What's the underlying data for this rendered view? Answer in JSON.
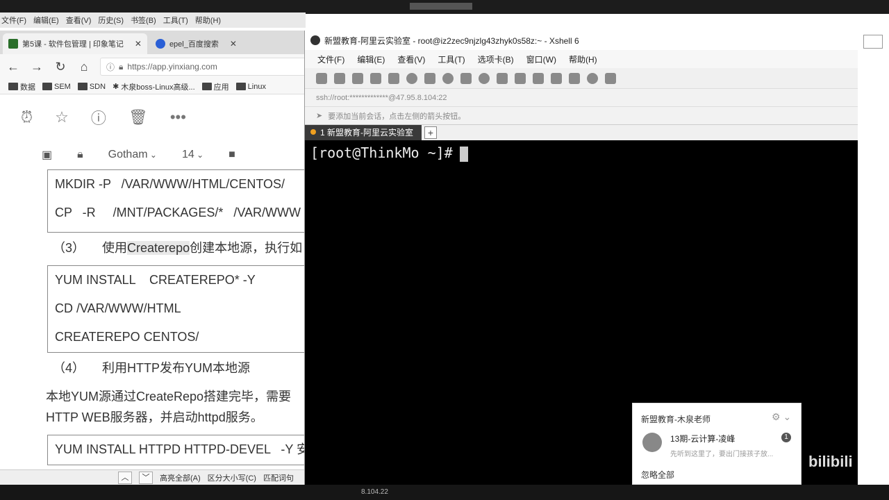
{
  "browser": {
    "menu": [
      "文件(F)",
      "编辑(E)",
      "查看(V)",
      "历史(S)",
      "书签(B)",
      "工具(T)",
      "帮助(H)"
    ],
    "tabs": [
      {
        "title": "第5课 - 软件包管理 | 印象笔记",
        "close": "✕"
      },
      {
        "title": "epel_百度搜索",
        "close": "✕"
      }
    ],
    "url": "https://app.yinxiang.com",
    "bookmarks": [
      "数据",
      "SEM",
      "SDN",
      "木泉boss-Linux高级...",
      "应用",
      "Linux"
    ]
  },
  "note": {
    "font_name": "Gotham",
    "font_size": "14",
    "box1": [
      "MKDIR -P   /VAR/WWW/HTML/CENTOS/",
      "CP   -R     /MNT/PACKAGES/*   /VAR/WWW"
    ],
    "step3_num": "（3）",
    "step3_pre": "使用",
    "step3_hl": "Createrepo",
    "step3_post": "创建本地源，执行如",
    "box2": [
      "YUM INSTALL    CREATEREPO* -Y",
      "CD /VAR/WWW/HTML",
      "CREATEREPO CENTOS/"
    ],
    "step4_num": "（4）",
    "step4_text": "利用HTTP发布YUM本地源",
    "para1": "本地YUM源通过CreateRepo搭建完毕，需要",
    "para2": "HTTP WEB服务器，并启动httpd服务。",
    "box3": [
      "YUM INSTALL HTTPD HTTPD-DEVEL   -Y 安装"
    ]
  },
  "findbar": {
    "up": "︿",
    "down": "﹀",
    "highlight_all": "高亮全部(A)",
    "match_case": "区分大小写(C)",
    "whole_word": "匹配词句"
  },
  "taskbar": {
    "text": "8.104.22"
  },
  "xshell": {
    "title": "新盟教育-阿里云实验室 - root@iz2zec9njzlg43zhyk0s58z:~ - Xshell 6",
    "menu": [
      "文件(F)",
      "编辑(E)",
      "查看(V)",
      "工具(T)",
      "选项卡(B)",
      "窗口(W)",
      "帮助(H)"
    ],
    "address": "ssh://root:*************@47.95.8.104:22",
    "hint": "要添加当前会话，点击左侧的箭头按钮。",
    "tab": "1 新盟教育-阿里云实验室",
    "add_tab": "+",
    "prompt": "[root@ThinkMo ~]#"
  },
  "notification": {
    "header": "新盟教育-木泉老师",
    "name": "13期-云计算-凌峰",
    "message": "先听到这里了，要出门接孩子放...",
    "badge": "1",
    "ignore": "忽略全部"
  },
  "watermark": "bilibili"
}
